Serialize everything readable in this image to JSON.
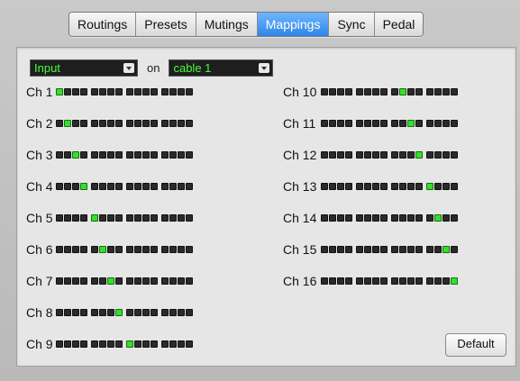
{
  "tabs": [
    {
      "label": "Routings",
      "active": false
    },
    {
      "label": "Presets",
      "active": false
    },
    {
      "label": "Mutings",
      "active": false
    },
    {
      "label": "Mappings",
      "active": true
    },
    {
      "label": "Sync",
      "active": false
    },
    {
      "label": "Pedal",
      "active": false
    }
  ],
  "selector": {
    "mode": "Input",
    "on_label": "on",
    "cable": "cable 1"
  },
  "channels_left": [
    {
      "label": "Ch 1",
      "on_index": 0
    },
    {
      "label": "Ch 2",
      "on_index": 1
    },
    {
      "label": "Ch 3",
      "on_index": 2
    },
    {
      "label": "Ch 4",
      "on_index": 3
    },
    {
      "label": "Ch 5",
      "on_index": 4
    },
    {
      "label": "Ch 6",
      "on_index": 5
    },
    {
      "label": "Ch 7",
      "on_index": 6
    },
    {
      "label": "Ch 8",
      "on_index": 7
    },
    {
      "label": "Ch 9",
      "on_index": 8
    }
  ],
  "channels_right": [
    {
      "label": "Ch 10",
      "on_index": 9
    },
    {
      "label": "Ch 11",
      "on_index": 10
    },
    {
      "label": "Ch 12",
      "on_index": 11
    },
    {
      "label": "Ch 13",
      "on_index": 12
    },
    {
      "label": "Ch 14",
      "on_index": 13
    },
    {
      "label": "Ch 15",
      "on_index": 14
    },
    {
      "label": "Ch 16",
      "on_index": 15
    }
  ],
  "default_button": "Default",
  "colors": {
    "led_on": "#33e02a",
    "led_off": "#2a2a2a",
    "selector_text": "#47ff37",
    "active_tab": "#2e86e8"
  }
}
